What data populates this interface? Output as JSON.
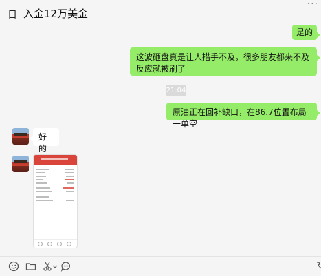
{
  "header": {
    "title_icon": "日",
    "title": "入金12万美金",
    "more_icon": "..."
  },
  "messages": [
    {
      "side": "right",
      "text": "是的"
    },
    {
      "side": "right",
      "text": "这波砸盘真是让人措手不及，很多朋友都来不及反应就被刷了"
    },
    {
      "side": "time",
      "text": "21:04"
    },
    {
      "side": "right",
      "text": "原油正在回补缺口，在86.7位置布局一单空"
    },
    {
      "side": "left",
      "text": "好的"
    },
    {
      "side": "left",
      "type": "image",
      "description_icon": "trade-screenshot-image"
    }
  ],
  "toolbar": {
    "icons": [
      "emoji-icon",
      "folder-icon",
      "scissors-icon",
      "chat-bubble-icon"
    ]
  },
  "colors": {
    "sent_bubble": "#95ec69",
    "received_bubble": "#ffffff",
    "background": "#f5f5f5"
  }
}
